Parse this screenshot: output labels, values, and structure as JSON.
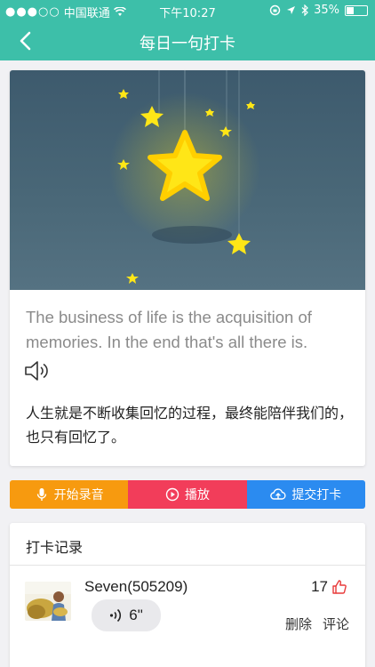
{
  "status_bar": {
    "signal": "●●●○○",
    "carrier": "中国联通",
    "time": "下午10:27",
    "battery": "35%"
  },
  "nav": {
    "title": "每日一句打卡"
  },
  "quote": {
    "english": "The business of life is the acquisition of memories. In the end that's all there is.",
    "chinese": "人生就是不断收集回忆的过程，最终能陪伴我们的，也只有回忆了。"
  },
  "actions": {
    "record_label": "开始录音",
    "play_label": "播放",
    "submit_label": "提交打卡"
  },
  "records": {
    "title": "打卡记录",
    "items": [
      {
        "username": "Seven(505209)",
        "duration": "6\"",
        "likes": "17",
        "delete_label": "删除",
        "comment_label": "评论"
      }
    ]
  },
  "colors": {
    "theme": "#3dbfa9",
    "record": "#f79a0f",
    "play": "#f23d5a",
    "submit": "#2b8bf0",
    "like": "#e83a3a",
    "star": "#ffe617"
  }
}
